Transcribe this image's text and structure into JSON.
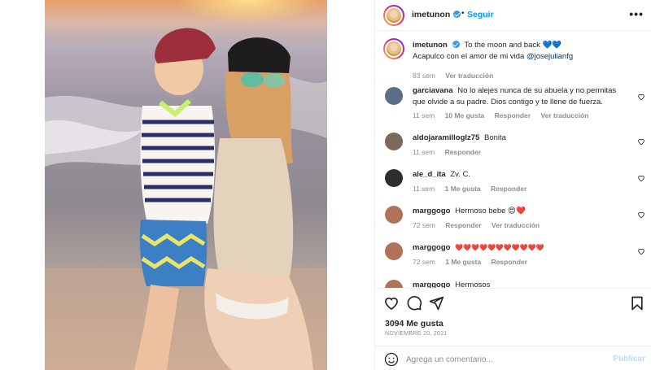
{
  "post": {
    "author": "imetunon",
    "follow_label": "Seguir",
    "more_label": "•••",
    "dot": "•"
  },
  "caption": {
    "username": "imetunon",
    "line1": "To the moon and back 💙💙",
    "line2_text": "Acapulco con el amor de mi vida ",
    "line2_mention": "@josejulianfg",
    "time": "83 sem",
    "translate": "Ver traducción"
  },
  "comments": [
    {
      "username": "garciavana",
      "text": "No lo alejes nunca de su abuela y no permitas que olvide a su padre. Dios contigo y te llene de fuerza.",
      "time": "11 sem",
      "likes": "10 Me gusta",
      "reply": "Responder",
      "translate": "Ver traducción",
      "avatar_color": "#5a6f86"
    },
    {
      "username": "aldojaramilloglz75",
      "text": "Bonita",
      "time": "11 sem",
      "reply": "Responder",
      "avatar_color": "#7a6a5c"
    },
    {
      "username": "ale_d_ita",
      "text": "Zv. C.",
      "time": "11 sem",
      "likes": "1 Me gusta",
      "reply": "Responder",
      "avatar_color": "#2e2e2e"
    },
    {
      "username": "marggogo",
      "text": "Hermoso bebe 😍❤️",
      "time": "72 sem",
      "reply": "Responder",
      "translate": "Ver traducción",
      "avatar_color": "#b0735a"
    },
    {
      "username": "marggogo",
      "text": "❤️❤️❤️❤️❤️❤️❤️❤️❤️❤️❤️",
      "time": "72 sem",
      "likes": "1 Me gusta",
      "reply": "Responder",
      "avatar_color": "#b0735a"
    },
    {
      "username": "marggogo",
      "text": "Hermosos",
      "avatar_color": "#b0735a"
    }
  ],
  "footer": {
    "likes": "3094 Me gusta",
    "date": "NOVIEMBRE 20, 2021",
    "comment_placeholder": "Agrega un comentario...",
    "publish_label": "Publicar"
  },
  "icons": {
    "like": "heart-icon",
    "comment": "comment-icon",
    "share": "send-icon",
    "save": "bookmark-icon",
    "emoji": "emoji-icon",
    "more": "more-icon",
    "verified": "verified-badge-icon"
  },
  "colors": {
    "accent": "#0095f6",
    "verified": "#3897f0",
    "secondary_text": "#8e8e8e",
    "publish_disabled": "#b2dffc"
  }
}
